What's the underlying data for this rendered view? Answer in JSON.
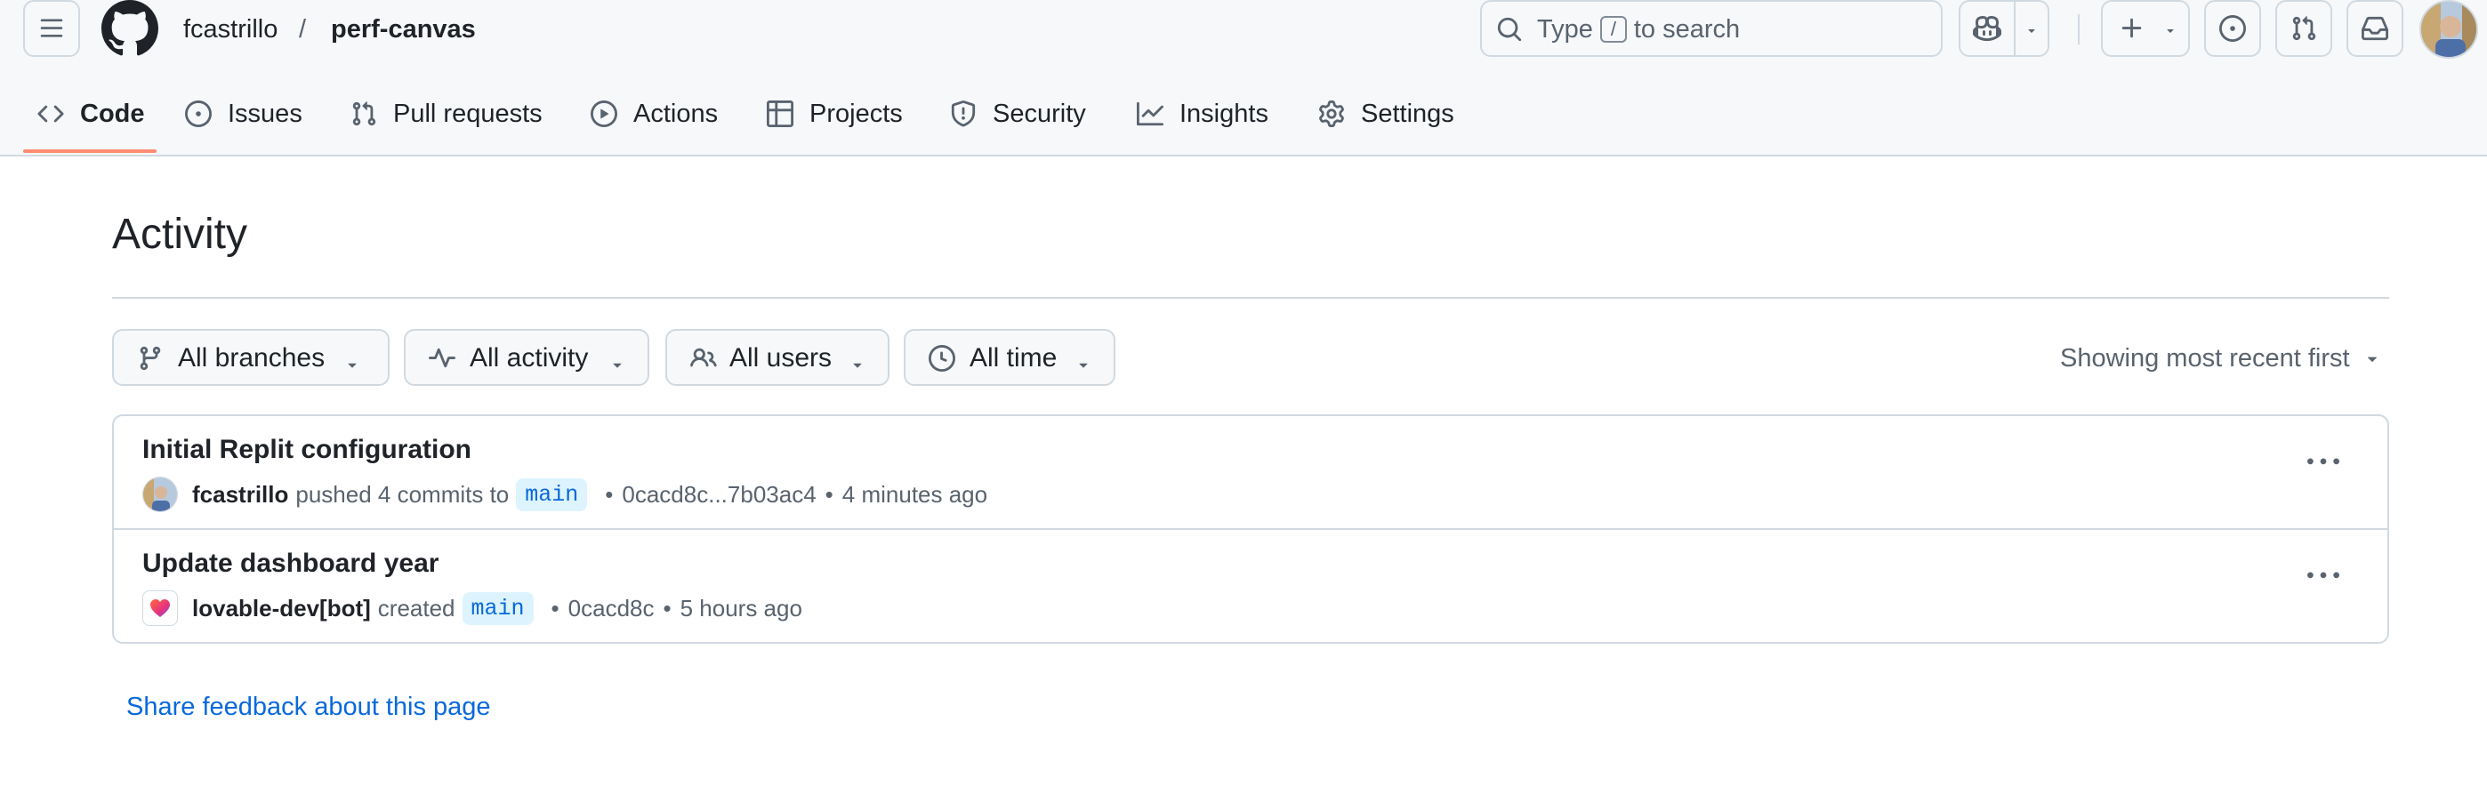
{
  "header": {
    "owner": "fcastrillo",
    "separator": "/",
    "repo": "perf-canvas",
    "search": {
      "prefix": "Type",
      "key": "/",
      "suffix": "to search"
    }
  },
  "tabs": [
    {
      "label": "Code",
      "icon": "code-icon",
      "active": true
    },
    {
      "label": "Issues",
      "icon": "issue-opened-icon"
    },
    {
      "label": "Pull requests",
      "icon": "git-pull-request-icon"
    },
    {
      "label": "Actions",
      "icon": "play-icon"
    },
    {
      "label": "Projects",
      "icon": "table-icon"
    },
    {
      "label": "Security",
      "icon": "shield-icon"
    },
    {
      "label": "Insights",
      "icon": "graph-icon"
    },
    {
      "label": "Settings",
      "icon": "gear-icon"
    }
  ],
  "page": {
    "title": "Activity"
  },
  "filters": [
    {
      "label": "All branches",
      "icon": "git-branch-icon"
    },
    {
      "label": "All activity",
      "icon": "pulse-icon"
    },
    {
      "label": "All users",
      "icon": "people-icon"
    },
    {
      "label": "All time",
      "icon": "clock-icon"
    }
  ],
  "sort": {
    "label": "Showing most recent first"
  },
  "activity": [
    {
      "title": "Initial Replit configuration",
      "user": "fcastrillo",
      "action": "pushed 4 commits to",
      "branch": "main",
      "commit": "0cacd8c...7b03ac4",
      "time": "4 minutes ago"
    },
    {
      "title": "Update dashboard year",
      "user": "lovable-dev[bot]",
      "action": "created",
      "branch": "main",
      "commit": "0cacd8c",
      "time": "5 hours ago"
    }
  ],
  "footer": {
    "feedback_link": "Share feedback about this page"
  },
  "colors": {
    "accent_underline": "#fd8c73",
    "link": "#0969da",
    "branch_pill_bg": "#ddf4ff",
    "border": "#d1d9e0"
  }
}
